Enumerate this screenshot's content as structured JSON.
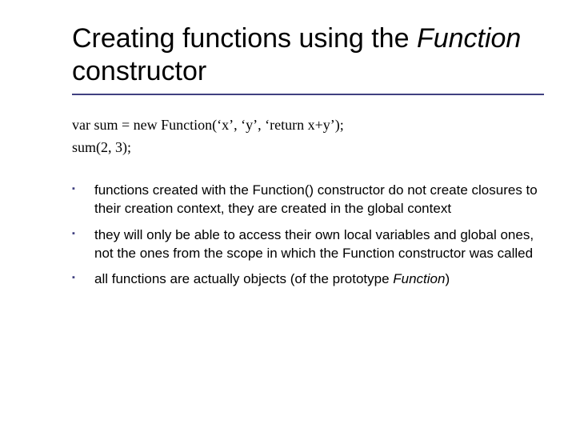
{
  "title": {
    "pre": "Creating functions using the ",
    "italic": "Function",
    "post": " constructor"
  },
  "code": {
    "line1": "var sum = new Function(‘x’, ‘y’, ‘return x+y’);",
    "line2": "sum(2, 3);"
  },
  "bullets": [
    {
      "text": "functions created with the Function() constructor do not create closures to their creation context, they are created in the global context"
    },
    {
      "text": "they will only be able to access their own local variables and global ones, not the ones from the scope in which the Function constructor was called"
    },
    {
      "pre": "all functions are actually objects (of the prototype ",
      "italic": "Function",
      "post": ")"
    }
  ]
}
